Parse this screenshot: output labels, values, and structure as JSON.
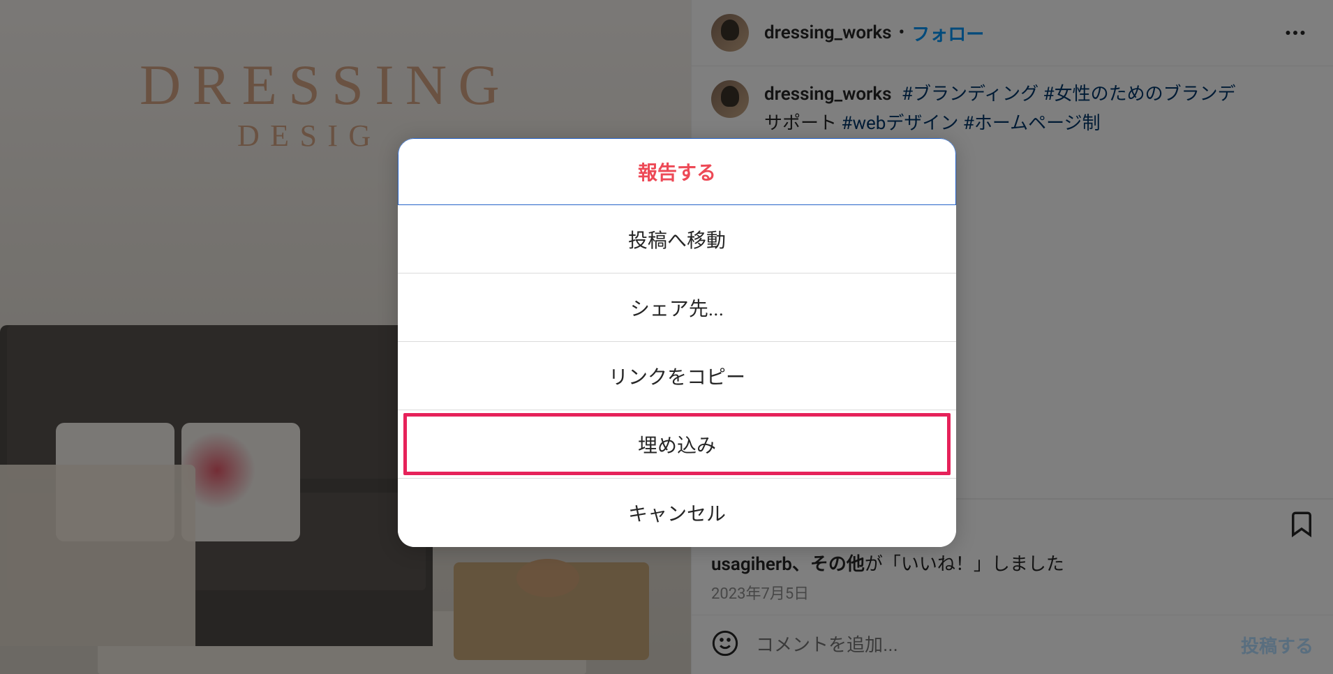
{
  "post": {
    "brand": {
      "line1": "DRESSING",
      "line2": "DESIG"
    },
    "header": {
      "username": "dressing_works",
      "separator": "•",
      "follow": "フォロー"
    },
    "caption": {
      "username": "dressing_works",
      "text_parts": [
        "#ブランディング",
        "#女性のためのブランデ",
        "サポート",
        "#webデザイン",
        "#ホームページ制"
      ]
    },
    "likes": {
      "name": "usagiherb",
      "suffix1": "、その他",
      "suffix2": "が「いいね！」しました"
    },
    "date": "2023年7月5日",
    "comment": {
      "placeholder": "コメントを追加...",
      "post_label": "投稿する"
    }
  },
  "modal": {
    "report": "報告する",
    "go_to_post": "投稿へ移動",
    "share_to": "シェア先...",
    "copy_link": "リンクをコピー",
    "embed": "埋め込み",
    "cancel": "キャンセル"
  }
}
